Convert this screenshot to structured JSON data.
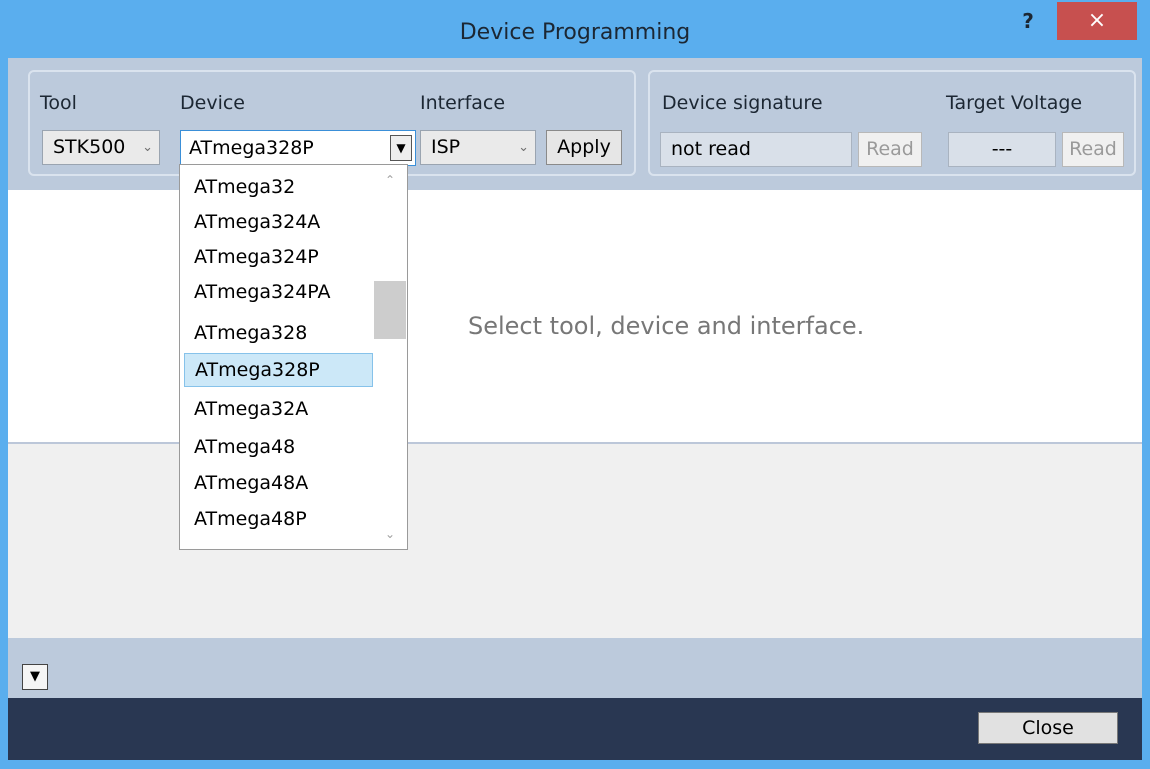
{
  "window": {
    "title": "Device Programming",
    "help": "?",
    "close_glyph": "×"
  },
  "tool": {
    "label": "Tool",
    "value": "STK500"
  },
  "device": {
    "label": "Device",
    "value": "ATmega328P"
  },
  "interface": {
    "label": "Interface",
    "value": "ISP",
    "apply": "Apply"
  },
  "signature": {
    "label": "Device signature",
    "value": "not read",
    "read": "Read"
  },
  "voltage": {
    "label": "Target Voltage",
    "value": "---",
    "read": "Read"
  },
  "message": "Select tool, device and interface.",
  "dropdown": {
    "items": [
      "ATmega32",
      "ATmega324A",
      "ATmega324P",
      "ATmega324PA",
      "ATmega328",
      "ATmega328P",
      "ATmega32A",
      "ATmega48",
      "ATmega48A",
      "ATmega48P"
    ],
    "selected": "ATmega328P"
  },
  "footer": {
    "close": "Close"
  }
}
